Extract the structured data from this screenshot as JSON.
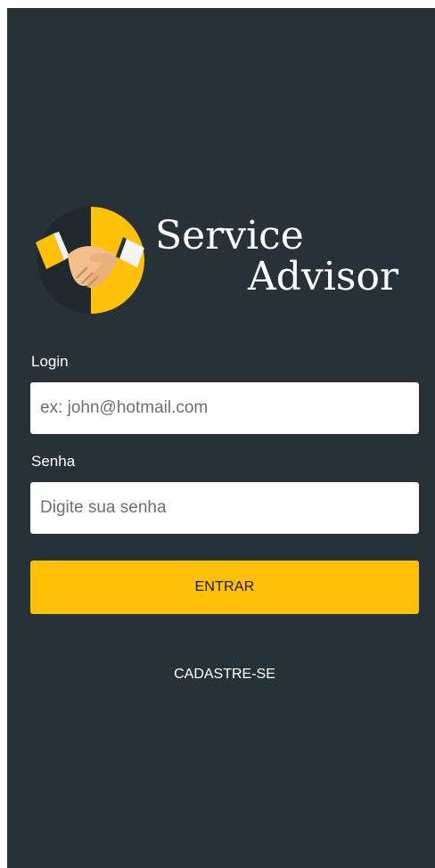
{
  "app": {
    "name_line1": "Service",
    "name_line2": "Advisor"
  },
  "logo": {
    "icon": "handshake-icon",
    "accent_color": "#FFC107",
    "background_color": "#263238"
  },
  "form": {
    "login": {
      "label": "Login",
      "placeholder": "ex: john@hotmail.com",
      "value": ""
    },
    "password": {
      "label": "Senha",
      "placeholder": "Digite sua senha",
      "value": ""
    }
  },
  "actions": {
    "submit_label": "ENTRAR",
    "register_label": "CADASTRE-SE"
  }
}
